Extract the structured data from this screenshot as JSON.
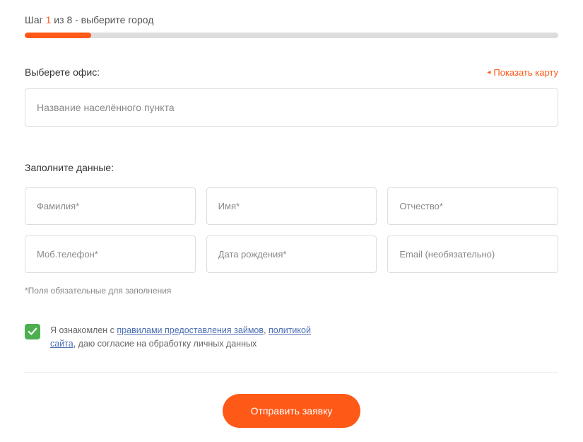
{
  "step": {
    "prefix": "Шаг ",
    "current": "1",
    "rest": " из 8 - выберите город"
  },
  "progress": {
    "percent": 12.5
  },
  "office": {
    "label": "Выберете офис:",
    "mapLink": "Показать карту",
    "placeholder": "Название населённого пункта"
  },
  "form": {
    "title": "Заполните данные:",
    "lastName": "Фамилия*",
    "firstName": "Имя*",
    "patronymic": "Отчество*",
    "phone": "Моб.телефон*",
    "birthdate": "Дата рождения*",
    "email": "Email (необязательно)",
    "requiredNote": "*Поля обязательные для заполнения"
  },
  "consent": {
    "pre": "Я ознакомлен с ",
    "link1": "правилами предоставления займов",
    "sep": ", ",
    "link2": "политикой сайта",
    "post": ", даю согласие на обработку личных данных"
  },
  "submit": {
    "label": "Отправить заявку"
  }
}
